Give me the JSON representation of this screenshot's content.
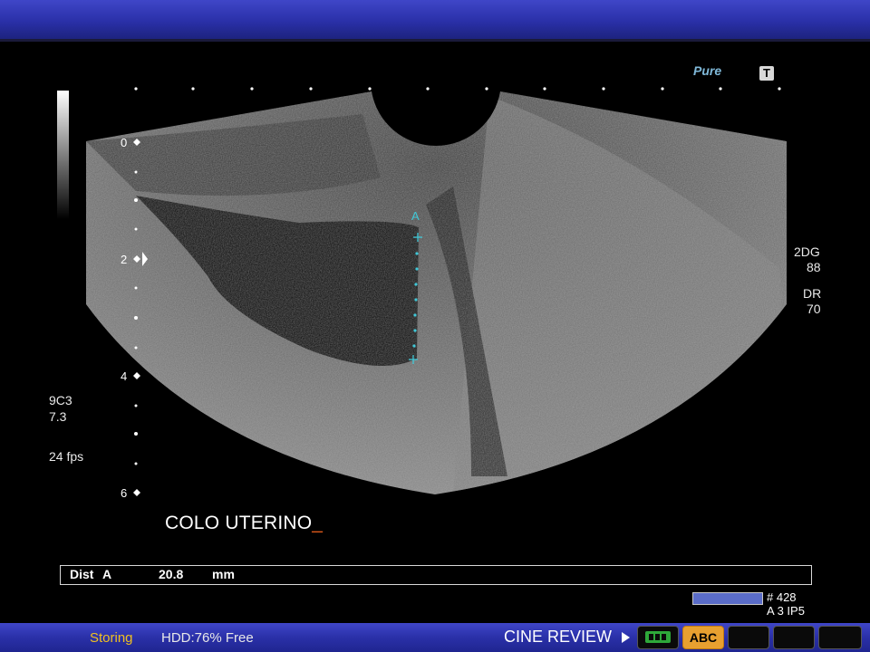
{
  "app": {
    "storing": "Storing",
    "hdd": "HDD:76% Free",
    "cine_review": "CINE REVIEW",
    "abc_label": "ABC"
  },
  "logo": {
    "text": "Pure",
    "t_icon": "T"
  },
  "probe": {
    "model": "9C3",
    "freq": "7.3",
    "fps": "24 fps"
  },
  "settings": {
    "gain_label": "2DG",
    "gain_value": "88",
    "dr_label": "DR",
    "dr_value": "70"
  },
  "depth_scale": {
    "labels": [
      "0",
      "2",
      "4",
      "6"
    ]
  },
  "caliper": {
    "marker": "A"
  },
  "annotation": {
    "text": "COLO UTERINO",
    "cursor": "_"
  },
  "measurement": {
    "label": "Dist",
    "id": "A",
    "value": "20.8",
    "unit": "mm"
  },
  "cine": {
    "frame": "# 428",
    "info": "A 3   IP5"
  },
  "colors": {
    "bar": "#2a30a8",
    "accent": "#f0c020",
    "caliper": "#40c8d8",
    "abc": "#e8a030"
  }
}
